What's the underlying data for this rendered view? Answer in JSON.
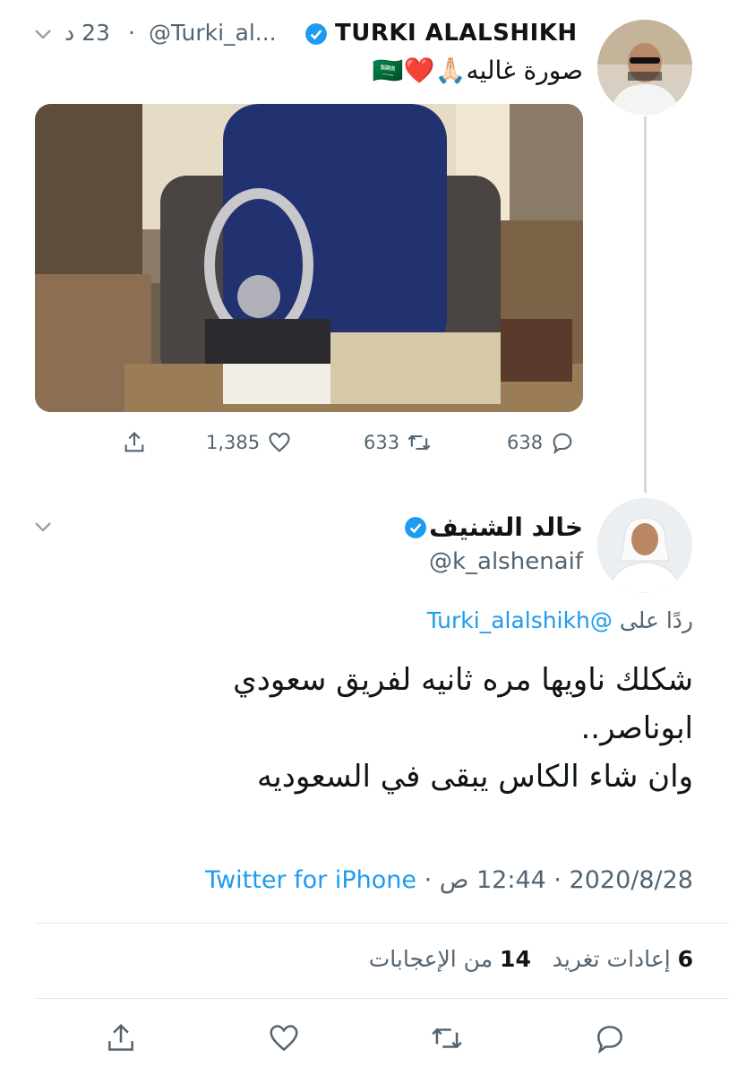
{
  "parent_tweet": {
    "name": "TURKI ALALSHIKH",
    "handle": "@Turki_al...",
    "separator": "·",
    "time": "23 د",
    "text": "صورة غاليه🙏🏻❤️🇸🇦",
    "actions": {
      "reply_count": "638",
      "retweet_count": "633",
      "like_count": "1,385"
    }
  },
  "reply_tweet": {
    "name": "خالد الشنيف",
    "handle": "@k_alshenaif",
    "reply_prefix": "ردًا على",
    "reply_to": "@Turki_alalshikh",
    "text_lines": [
      "شكلك ناويها مره ثانيه لفريق سعودي",
      "ابوناصر..",
      "وان شاء الكاس يبقى في السعوديه"
    ],
    "timestamp": "2020/8/28 · 12:44 ص ·",
    "source": "Twitter for iPhone",
    "stats": {
      "retweets_count": "6",
      "retweets_label": "إعادات تغريد",
      "likes_count": "14",
      "likes_label": "من الإعجابات"
    }
  },
  "colors": {
    "accent": "#1d9bf0",
    "secondary_text": "#536471",
    "primary_text": "#0f1419",
    "divider": "#e1e8ed"
  }
}
